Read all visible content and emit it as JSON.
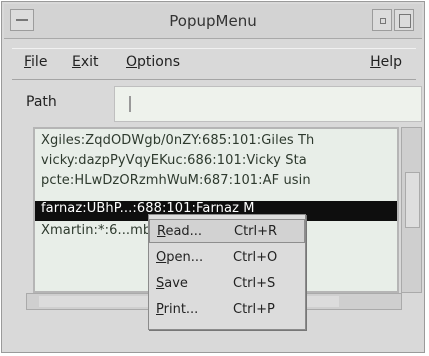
{
  "window": {
    "title": "PopupMenu"
  },
  "menubar": {
    "file": {
      "mnemonic": "F",
      "rest": "ile"
    },
    "exit": {
      "mnemonic": "E",
      "rest": "xit"
    },
    "options": {
      "mnemonic": "O",
      "rest": "ptions"
    },
    "help": {
      "mnemonic": "H",
      "rest": "elp"
    }
  },
  "path": {
    "label": "Path",
    "value": ""
  },
  "list": {
    "rows": [
      "Xgiles:ZqdODWgb/0nZY:685:101:Giles Th",
      "vicky:dazpPyVqyEKuc:686:101:Vicky Sta",
      "pcte:HLwDzORzmhWuM:687:101:AF usin",
      "farnaz:UBhP...:688:101:Farnaz M",
      "Xmartin:*:6...mbert:/u/n"
    ],
    "selected_index": 3
  },
  "popup": {
    "items": [
      {
        "mnemonic": "R",
        "rest": "ead...",
        "accelerator": "Ctrl+R"
      },
      {
        "mnemonic": "O",
        "rest": "pen...",
        "accelerator": "Ctrl+O"
      },
      {
        "mnemonic": "S",
        "rest": "ave",
        "accelerator": "Ctrl+S"
      },
      {
        "mnemonic": "P",
        "rest": "rint...",
        "accelerator": "Ctrl+P"
      }
    ],
    "active_index": 0
  }
}
